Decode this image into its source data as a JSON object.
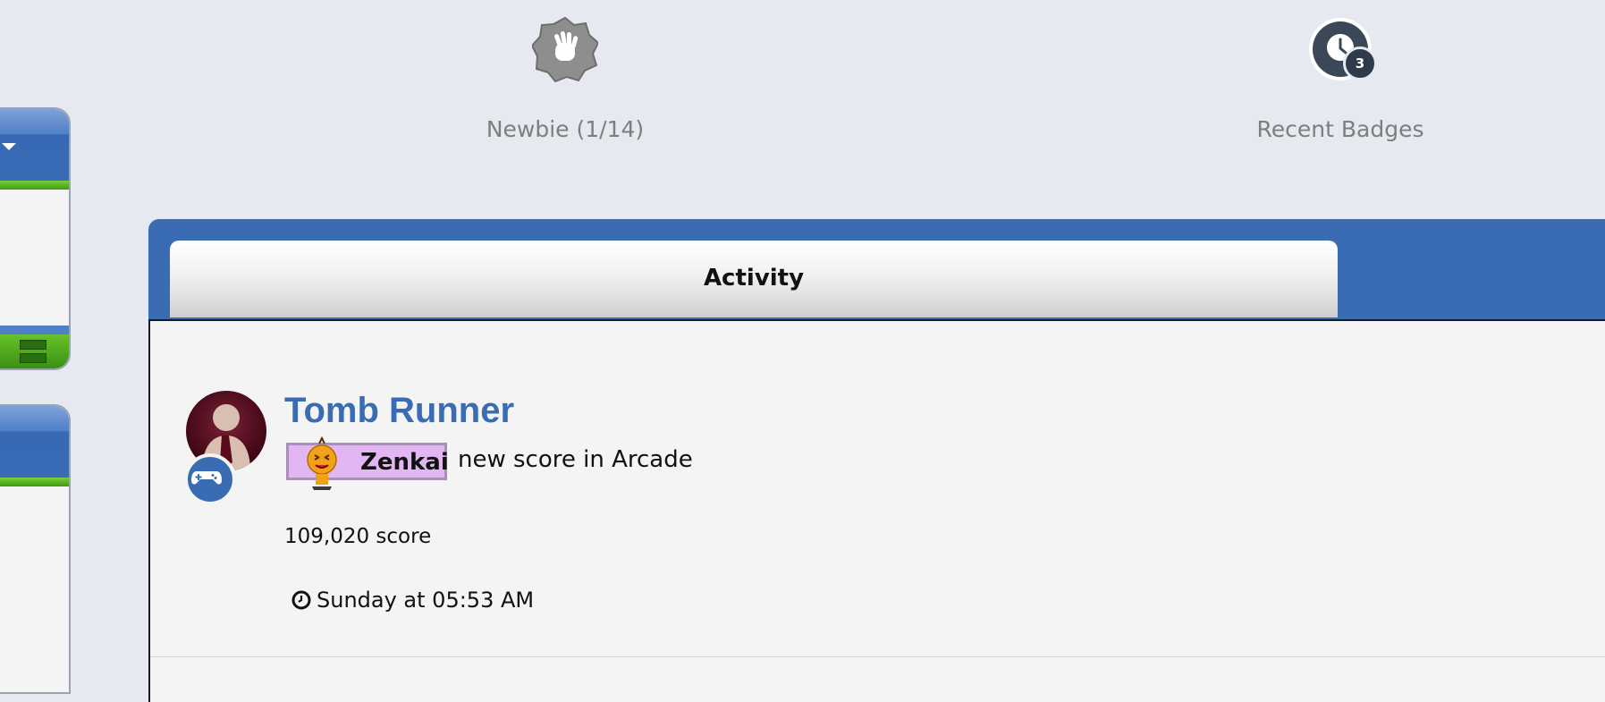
{
  "badges": [
    {
      "label": "Newbie (1/14)",
      "icon": "waving-hand-icon"
    },
    {
      "label": "Recent Badges",
      "icon": "clock-icon",
      "count": "3"
    }
  ],
  "tabs": [
    {
      "label": "Activity"
    }
  ],
  "activity": {
    "title": "Tomb Runner",
    "username": "Zenkai",
    "action": "new score in Arcade",
    "score": "109,020 score",
    "time": "Sunday at 05:53 AM"
  },
  "colors": {
    "accent": "#3a6cb4",
    "user_pill": "#e2b6f3",
    "green": "#5ab825"
  }
}
